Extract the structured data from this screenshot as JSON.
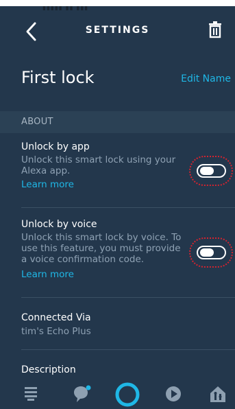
{
  "header": {
    "title": "SETTINGS"
  },
  "device": {
    "name": "First lock",
    "edit_label": "Edit Name"
  },
  "section": {
    "label": "ABOUT"
  },
  "rows": [
    {
      "title": "Unlock by app",
      "description": "Unlock this smart lock using your Alexa app.",
      "learn_more": "Learn more",
      "enabled": false
    },
    {
      "title": "Unlock by voice",
      "description": "Unlock this smart lock by voice. To use this feature, you must provide a voice confirmation code.",
      "learn_more": "Learn more",
      "enabled": false
    }
  ],
  "connected": {
    "title": "Connected Via",
    "value": "tim's Echo Plus"
  },
  "description_row": {
    "title": "Description"
  },
  "nav": {
    "items": [
      "home-icon",
      "communicate-icon",
      "alexa-icon",
      "play-icon",
      "devices-icon"
    ]
  },
  "colors": {
    "background": "#23374c",
    "accent": "#1fb7e6",
    "highlight": "#d6232f"
  }
}
